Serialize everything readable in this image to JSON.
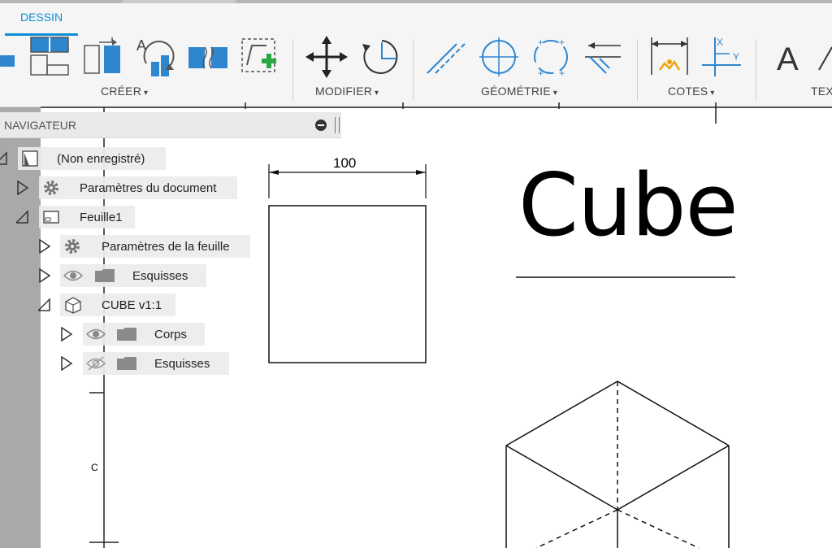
{
  "ribbon": {
    "active_tab": "DESSIN",
    "groups": [
      {
        "label": "CRÉER",
        "caret": "▾"
      },
      {
        "label": "MODIFIER",
        "caret": "▾"
      },
      {
        "label": "GÉOMÉTRIE",
        "caret": "▾"
      },
      {
        "label": "COTES",
        "caret": "▾"
      },
      {
        "label": "TEX"
      }
    ],
    "text_tool_glyph": "A",
    "dimension_tool_axes": {
      "x": "X",
      "y": "Y"
    },
    "accent_color": "#0a8fd6"
  },
  "navigator": {
    "title": "NAVIGATEUR",
    "items": [
      {
        "label": "(Non enregistré)",
        "icon": "sheet-doc-icon"
      },
      {
        "label": "Paramètres du document",
        "icon": "gear-icon"
      },
      {
        "label": "Feuille1",
        "icon": "sheet-icon"
      },
      {
        "label": "Paramètres de la feuille",
        "icon": "gear-icon"
      },
      {
        "label": "Esquisses",
        "icon": "folder-icon"
      },
      {
        "label": "CUBE v1:1",
        "icon": "cube-icon"
      },
      {
        "label": "Corps",
        "icon": "folder-icon"
      },
      {
        "label": "Esquisses",
        "icon": "folder-icon"
      }
    ]
  },
  "drawing": {
    "title": "Cube",
    "dimension": "100",
    "ruler_label": "C"
  }
}
